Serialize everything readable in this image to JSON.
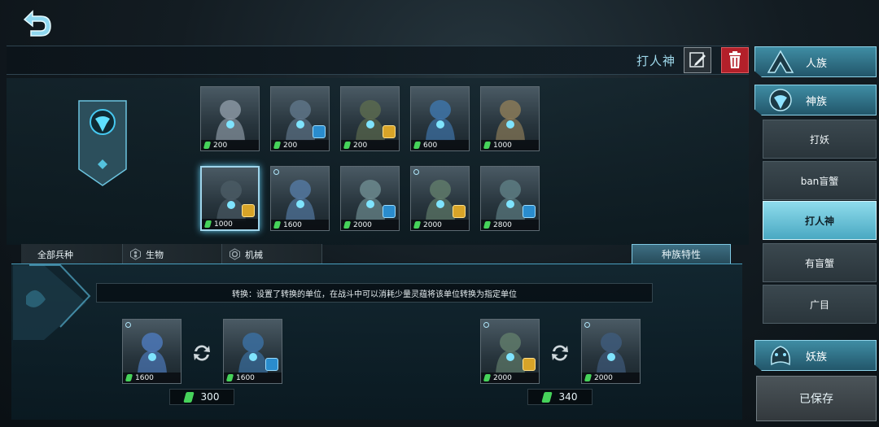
{
  "header": {
    "deck_name": "打人神"
  },
  "roster_cards": [
    {
      "cost": "200",
      "badge": "none"
    },
    {
      "cost": "200",
      "badge": "blue"
    },
    {
      "cost": "200",
      "badge": "gold"
    },
    {
      "cost": "600",
      "badge": "none"
    },
    {
      "cost": "1000",
      "badge": "none"
    },
    {
      "cost": "1000",
      "badge": "gold"
    },
    {
      "cost": "1600",
      "badge": "none"
    },
    {
      "cost": "2000",
      "badge": "blue"
    },
    {
      "cost": "2000",
      "badge": "gold"
    },
    {
      "cost": "2800",
      "badge": "blue"
    }
  ],
  "filters": {
    "all": "全部兵种",
    "bio": "生物",
    "mech": "机械"
  },
  "trait_tab": "种族特性",
  "trait_description": "转换：设置了转换的单位，在战斗中可以消耗少量灵蕴将该单位转换为指定单位",
  "conversions": [
    {
      "from_cost": "1600",
      "to_cost": "1600",
      "price": "300"
    },
    {
      "from_cost": "2000",
      "to_cost": "2000",
      "price": "340"
    }
  ],
  "sidebar": {
    "races": [
      "人族",
      "神族",
      "妖族"
    ],
    "decks": [
      "打妖",
      "ban盲蟹",
      "打人神",
      "有盲蟹",
      "广目"
    ],
    "active_deck": "打人神",
    "saved_label": "已保存"
  },
  "colors": {
    "accent": "#5fc4e8",
    "gem": "#46d25a",
    "delete": "#b3202a"
  }
}
